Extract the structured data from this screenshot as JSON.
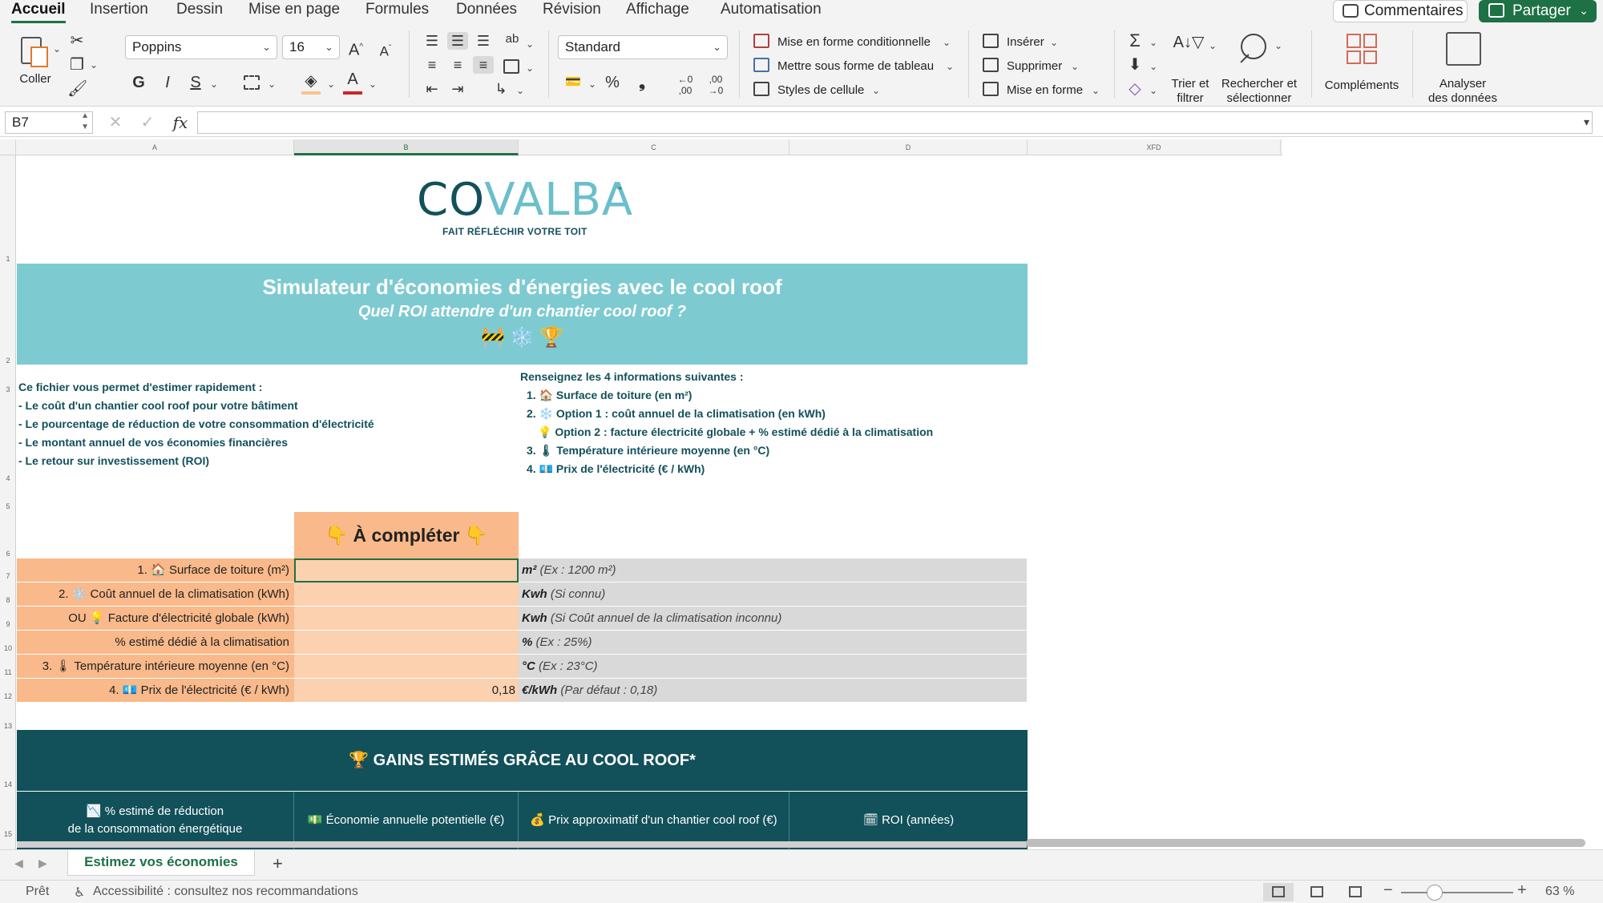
{
  "menu": {
    "tabs": [
      "Accueil",
      "Insertion",
      "Dessin",
      "Mise en page",
      "Formules",
      "Données",
      "Révision",
      "Affichage",
      "Automatisation"
    ],
    "active_tab": "Accueil",
    "comments_label": "Commentaires",
    "share_label": "Partager"
  },
  "ribbon": {
    "paste_label": "Coller",
    "font_name": "Poppins",
    "font_size": "16",
    "grow_font": "A^",
    "shrink_font": "Aˇ",
    "bold": "G",
    "italic": "I",
    "underline": "S",
    "number_format": "Standard",
    "percent": "%",
    "comma": "❟",
    "conditional_format": "Mise en forme conditionnelle",
    "format_as_table": "Mettre sous forme de tableau",
    "cell_styles": "Styles de cellule",
    "insert": "Insérer",
    "delete": "Supprimer",
    "format": "Mise en forme",
    "sort_filter": "Trier et\nfiltrer",
    "sort_filter_l1": "Trier et",
    "sort_filter_l2": "filtrer",
    "find_select_l1": "Rechercher et",
    "find_select_l2": "sélectionner",
    "addins": "Compléments",
    "analyze_l1": "Analyser",
    "analyze_l2": "des données"
  },
  "formula_bar": {
    "name_box": "B7",
    "formula": ""
  },
  "columns": [
    "A",
    "B",
    "C",
    "D",
    "XFD"
  ],
  "selected_column": "B",
  "rows": [
    "1",
    "2",
    "3",
    "4",
    "5",
    "6",
    "7",
    "8",
    "9",
    "10",
    "11",
    "12",
    "13",
    "14",
    "15"
  ],
  "sheet": {
    "logo": {
      "dark": "CO",
      "light": "VALBA",
      "tm": "™",
      "tagline": "FAIT RÉFLÉCHIR VOTRE TOIT"
    },
    "banner": {
      "title": "Simulateur d'économies d'énergies avec le cool roof",
      "subtitle": "Quel ROI attendre d'un chantier cool roof ?",
      "emojis": "🚧 ❄️ 🏆"
    },
    "intro_left": [
      "Ce fichier vous permet d'estimer rapidement :",
      "- Le coût d'un chantier cool roof pour votre bâtiment",
      "- Le pourcentage de réduction de votre consommation d'électricité",
      "- Le montant annuel de vos économies financières",
      "- Le retour sur investissement (ROI)"
    ],
    "intro_right": [
      "Renseignez les 4 informations suivantes :",
      "1. 🏠 Surface de toiture (en m²)",
      "2. ❄️ Option 1 : coût annuel de la climatisation (en kWh)",
      "💡 Option 2 : facture électricité globale + % estimé dédié à la climatisation",
      "3. 🌡 Température intérieure moyenne (en °C)",
      "4. 💶 Prix de l'électricité (€ / kWh)"
    ],
    "to_complete": "👇 À compléter 👇",
    "form_rows": [
      {
        "label": "1. 🏠 Surface de toiture (m²)",
        "value": "",
        "unit": "m²",
        "hint": "(Ex : 1200 m²)"
      },
      {
        "label": "2. ❄️ Coût annuel de la climatisation (kWh)",
        "value": "",
        "unit": "Kwh",
        "hint": "(Si connu)"
      },
      {
        "label": "OU 💡 Facture d'électricité globale (kWh)",
        "value": "",
        "unit": "Kwh",
        "hint": "(Si Coût annuel de la climatisation inconnu)"
      },
      {
        "label": "% estimé dédié à la climatisation",
        "value": "",
        "unit": "%",
        "hint": "(Ex : 25%)"
      },
      {
        "label": "3. 🌡 Température intérieure moyenne (en °C)",
        "value": "",
        "unit": "°C",
        "hint": "(Ex : 23°C)"
      },
      {
        "label": "4. 💶 Prix de l'électricité (€ / kWh)",
        "value": "0,18",
        "unit": "€/kWh",
        "hint": "(Par défaut : 0,18)"
      }
    ],
    "gains_title": "🏆 GAINS ESTIMÉS GRÂCE AU COOL ROOF*",
    "gains_headers": [
      "📉 % estimé de réduction\nde la consommation énergétique",
      "💵 Économie annuelle potentielle (€)",
      "💰 Prix approximatif d'un chantier cool roof (€)",
      "🗓 ROI (années)"
    ]
  },
  "sheet_tabs": [
    "Estimez vos économies"
  ],
  "status": {
    "ready": "Prêt",
    "accessibility": "Accessibilité : consultez nos recommandations",
    "zoom": "63 %"
  },
  "colors": {
    "excel_green": "#1e7145",
    "banner_teal": "#7ecad1",
    "dark_teal": "#12505a",
    "orange_label": "#f9b98a",
    "orange_input": "#fbd1b0",
    "grey_unit": "#d9d9d9"
  }
}
